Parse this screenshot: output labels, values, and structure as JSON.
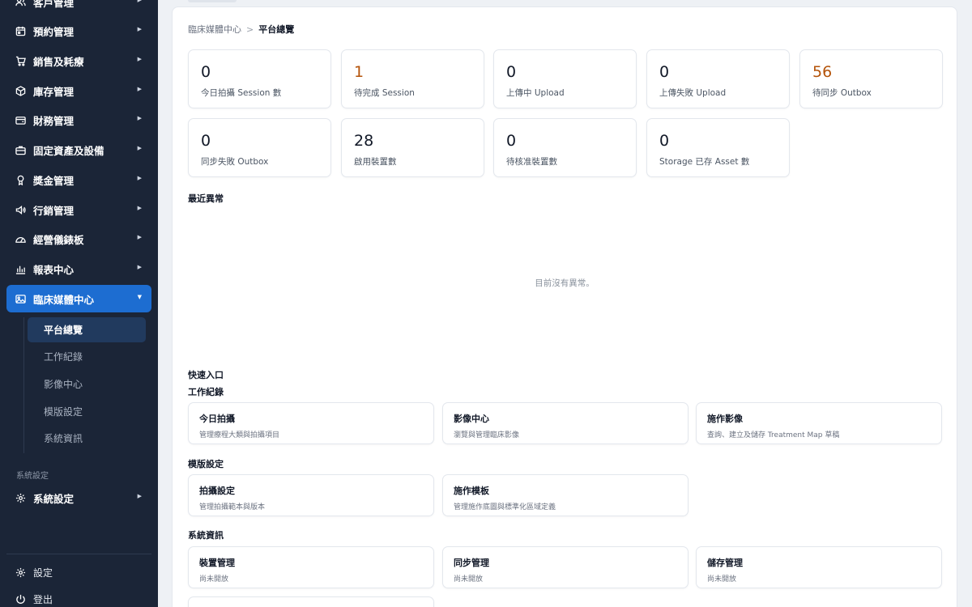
{
  "sidebar": {
    "nav": [
      {
        "label": "客戶管理",
        "icon": "users-icon"
      },
      {
        "label": "預約管理",
        "icon": "calendar-icon"
      },
      {
        "label": "銷售及耗療",
        "icon": "cart-icon"
      },
      {
        "label": "庫存管理",
        "icon": "box-icon"
      },
      {
        "label": "財務管理",
        "icon": "wallet-icon"
      },
      {
        "label": "固定資產及設備",
        "icon": "briefcase-icon"
      },
      {
        "label": "獎金管理",
        "icon": "trophy-icon"
      },
      {
        "label": "行銷管理",
        "icon": "megaphone-icon"
      },
      {
        "label": "經營儀錶板",
        "icon": "gauge-icon"
      },
      {
        "label": "報表中心",
        "icon": "bar-chart-icon"
      },
      {
        "label": "臨床媒體中心",
        "icon": "image-icon"
      }
    ],
    "sub": [
      "平台總覽",
      "工作紀錄",
      "影像中心",
      "模版設定",
      "系統資訊"
    ],
    "section_label": "系統設定",
    "system": {
      "label": "系統設定",
      "icon": "gear-icon"
    },
    "footer": [
      {
        "label": "設定",
        "icon": "settings-icon"
      },
      {
        "label": "登出",
        "icon": "power-icon"
      }
    ]
  },
  "breadcrumb": {
    "parent": "臨床媒體中心",
    "separator": ">",
    "current": "平台總覽"
  },
  "stats": [
    {
      "value": "0",
      "label": "今日拍攝 Session 數"
    },
    {
      "value": "1",
      "label": "待完成 Session"
    },
    {
      "value": "0",
      "label": "上傳中 Upload"
    },
    {
      "value": "0",
      "label": "上傳失敗 Upload"
    },
    {
      "value": "56",
      "label": "待同步 Outbox"
    },
    {
      "value": "0",
      "label": "同步失敗 Outbox"
    },
    {
      "value": "28",
      "label": "啟用裝置數"
    },
    {
      "value": "0",
      "label": "待核准裝置數"
    },
    {
      "value": "0",
      "label": "Storage 已存 Asset 數"
    }
  ],
  "colors": {
    "warning_value": "#b45309",
    "active_nav": "#1d6dd1",
    "sidebar_bg": "#1b2537"
  },
  "anomalies": {
    "title": "最近異常",
    "empty": "目前沒有異常。"
  },
  "quick": {
    "title": "快速入口",
    "groups": [
      {
        "title": "工作紀錄",
        "items": [
          {
            "title": "今日拍攝",
            "desc": "管理療程大類與拍攝項目"
          },
          {
            "title": "影像中心",
            "desc": "瀏覽與管理臨床影像"
          },
          {
            "title": "施作影像",
            "desc": "查詢、建立及儲存 Treatment Map 草稿"
          }
        ]
      },
      {
        "title": "模版設定",
        "items": [
          {
            "title": "拍攝設定",
            "desc": "管理拍攝範本與版本"
          },
          {
            "title": "施作模板",
            "desc": "管理施作底圖與標準化區域定義"
          }
        ]
      },
      {
        "title": "系統資訊",
        "items": [
          {
            "title": "裝置管理",
            "desc": "尚未開放"
          },
          {
            "title": "同步管理",
            "desc": "尚未開放"
          },
          {
            "title": "儲存管理",
            "desc": "尚未開放"
          }
        ]
      }
    ]
  }
}
